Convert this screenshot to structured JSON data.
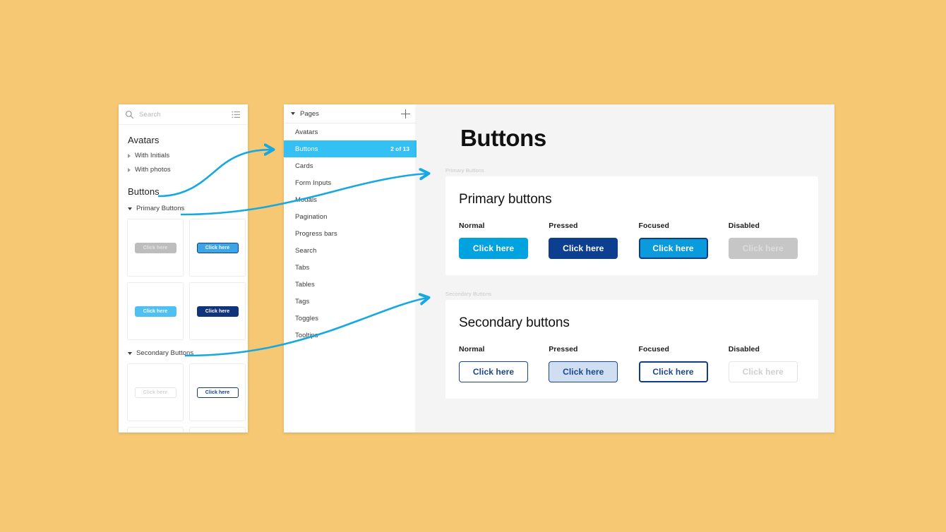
{
  "canvas": {
    "background": "#f7c873",
    "accent": "#00a3e0"
  },
  "layers_panel": {
    "search": {
      "placeholder": "Search",
      "icon": "search-icon",
      "list_icon": "list-view-icon"
    },
    "groups": [
      {
        "label": "Avatars",
        "type": "heading"
      },
      {
        "label": "With Initials",
        "type": "sub",
        "expanded": false
      },
      {
        "label": "With photos",
        "type": "sub",
        "expanded": false
      },
      {
        "label": "Buttons",
        "type": "heading"
      },
      {
        "label": "Primary Buttons",
        "type": "sub",
        "expanded": true
      },
      {
        "label": "Secondary Buttons",
        "type": "sub",
        "expanded": true
      }
    ],
    "primary_thumbs": [
      {
        "label": "Click here",
        "state": "p-disabled"
      },
      {
        "label": "Click here",
        "state": "p-focused"
      },
      {
        "label": "Click here",
        "state": "p-normal"
      },
      {
        "label": "Click here",
        "state": "p-pressed"
      }
    ],
    "secondary_thumbs": [
      {
        "label": "Click here",
        "state": "s-disabled"
      },
      {
        "label": "Click here",
        "state": "s-focused"
      }
    ]
  },
  "pages_panel": {
    "header": {
      "label": "Pages",
      "expanded": true,
      "add_icon": "plus-icon"
    },
    "items": [
      {
        "label": "Avatars",
        "active": false,
        "count": ""
      },
      {
        "label": "Buttons",
        "active": true,
        "count": "2 of 13"
      },
      {
        "label": "Cards",
        "active": false,
        "count": ""
      },
      {
        "label": "Form Inputs",
        "active": false,
        "count": ""
      },
      {
        "label": "Modals",
        "active": false,
        "count": ""
      },
      {
        "label": "Pagination",
        "active": false,
        "count": ""
      },
      {
        "label": "Progress bars",
        "active": false,
        "count": ""
      },
      {
        "label": "Search",
        "active": false,
        "count": ""
      },
      {
        "label": "Tabs",
        "active": false,
        "count": ""
      },
      {
        "label": "Tables",
        "active": false,
        "count": ""
      },
      {
        "label": "Tags",
        "active": false,
        "count": ""
      },
      {
        "label": "Toggles",
        "active": false,
        "count": ""
      },
      {
        "label": "Tooltips",
        "active": false,
        "count": ""
      }
    ]
  },
  "main": {
    "title": "Buttons",
    "sections": [
      {
        "layer_label": "Primary Buttons",
        "heading": "Primary buttons",
        "states": [
          {
            "label": "Normal",
            "button": "Click here",
            "style": "pri-normal"
          },
          {
            "label": "Pressed",
            "button": "Click here",
            "style": "pri-pressed"
          },
          {
            "label": "Focused",
            "button": "Click here",
            "style": "pri-focused"
          },
          {
            "label": "Disabled",
            "button": "Click here",
            "style": "pri-disabled"
          }
        ]
      },
      {
        "layer_label": "Secondary Buttons",
        "heading": "Secondary buttons",
        "states": [
          {
            "label": "Normal",
            "button": "Click here",
            "style": "sec-normal"
          },
          {
            "label": "Pressed",
            "button": "Click here",
            "style": "sec-pressed"
          },
          {
            "label": "Focused",
            "button": "Click here",
            "style": "sec-focused"
          },
          {
            "label": "Disabled",
            "button": "Click here",
            "style": "sec-disabled"
          }
        ]
      }
    ]
  },
  "annotations": {
    "arrow_color": "#16a8e0",
    "arrows": [
      {
        "name": "buttons-layer-to-pages-item"
      },
      {
        "name": "primary-buttons-layer-to-primary-section"
      },
      {
        "name": "secondary-buttons-layer-to-secondary-section"
      }
    ]
  }
}
